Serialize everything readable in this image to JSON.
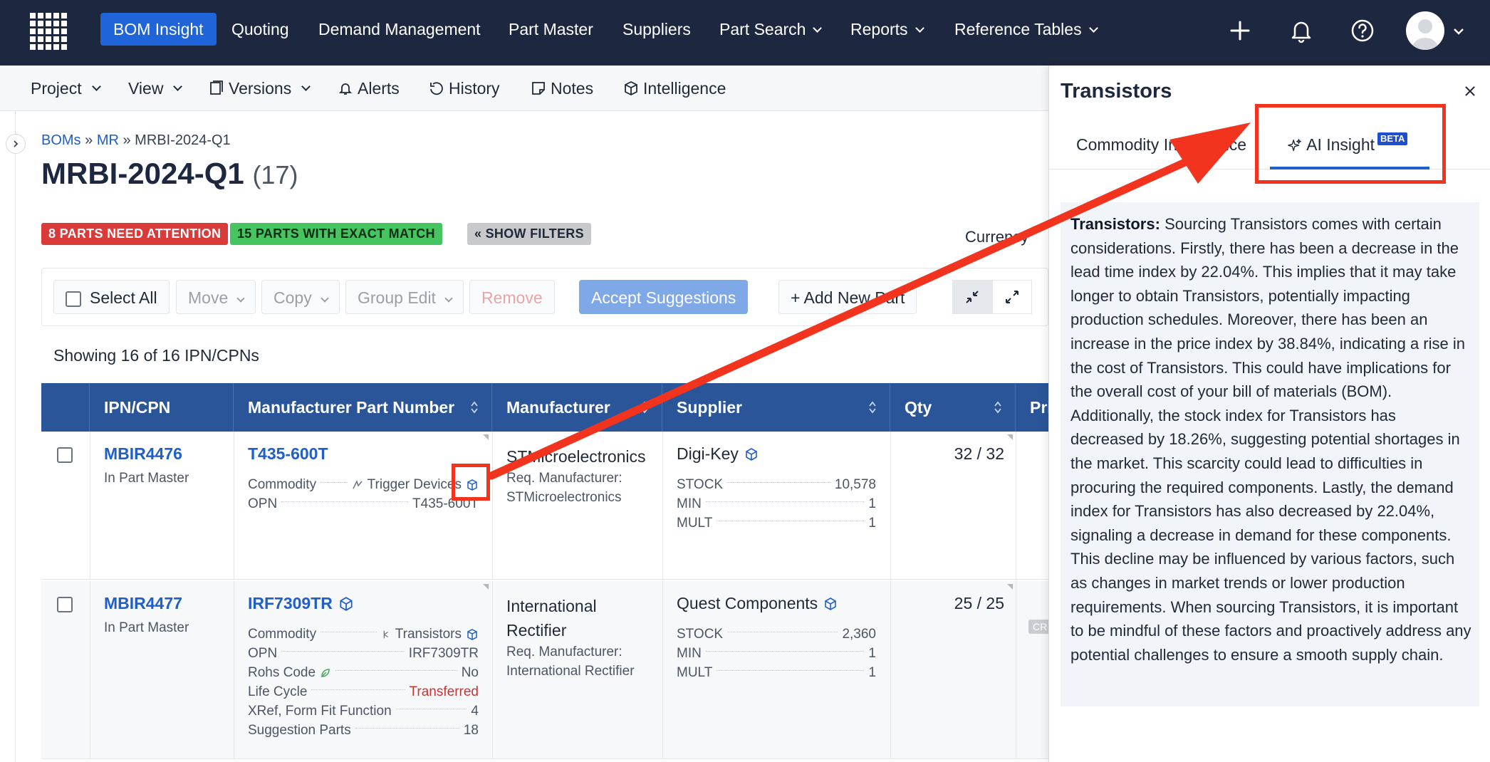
{
  "nav": {
    "items": [
      "BOM Insight",
      "Quoting",
      "Demand Management",
      "Part Master",
      "Suppliers",
      "Part Search",
      "Reports",
      "Reference Tables"
    ]
  },
  "toolbar": {
    "project": "Project",
    "view": "View",
    "versions": "Versions",
    "alerts": "Alerts",
    "history": "History",
    "notes": "Notes",
    "intelligence": "Intelligence"
  },
  "breadcrumb": {
    "boms": "BOMs",
    "sep": "»",
    "mr": "MR",
    "current": "MRBI-2024-Q1"
  },
  "page": {
    "title": "MRBI-2024-Q1",
    "count": "(17)"
  },
  "badges": {
    "attention": "8 PARTS NEED ATTENTION",
    "exact": "15 PARTS WITH EXACT MATCH",
    "filters": "« SHOW FILTERS"
  },
  "currency_label": "Currency",
  "actions": {
    "select_all": "Select All",
    "move": "Move",
    "copy": "Copy",
    "group_edit": "Group Edit",
    "remove": "Remove",
    "accept": "Accept Suggestions",
    "add_new": "+ Add New Part"
  },
  "showing": "Showing 16 of 16 IPN/CPNs",
  "table": {
    "headers": [
      "IPN/CPN",
      "Manufacturer Part Number",
      "Manufacturer",
      "Supplier",
      "Qty",
      "Pri"
    ],
    "rows": [
      {
        "ipn": "MBIR4476",
        "ipn_sub": "In Part Master",
        "mpn": "T435-600T",
        "attrs": [
          {
            "k": "Commodity",
            "v": "Trigger Devices"
          },
          {
            "k": "OPN",
            "v": "T435-600T"
          }
        ],
        "manufacturer": "STMicroelectronics",
        "req_label": "Req. Manufacturer:",
        "req_value": "STMicroelectronics",
        "supplier": "Digi-Key",
        "stock": [
          {
            "k": "STOCK",
            "v": "10,578"
          },
          {
            "k": "MIN",
            "v": "1"
          },
          {
            "k": "MULT",
            "v": "1"
          }
        ],
        "qty": "32 / 32"
      },
      {
        "ipn": "MBIR4477",
        "ipn_sub": "In Part Master",
        "mpn": "IRF7309TR",
        "attrs": [
          {
            "k": "Commodity",
            "v": "Transistors"
          },
          {
            "k": "OPN",
            "v": "IRF7309TR"
          },
          {
            "k": "Rohs Code",
            "v": "No"
          },
          {
            "k": "Life Cycle",
            "v": "Transferred"
          },
          {
            "k": "XRef, Form Fit Function",
            "v": "4"
          },
          {
            "k": "Suggestion Parts",
            "v": "18"
          }
        ],
        "manufacturer_l1": "International",
        "manufacturer_l2": "Rectifier",
        "req_label": "Req. Manufacturer:",
        "req_value": "International Rectifier",
        "supplier": "Quest Components",
        "stock": [
          {
            "k": "STOCK",
            "v": "2,360"
          },
          {
            "k": "MIN",
            "v": "1"
          },
          {
            "k": "MULT",
            "v": "1"
          }
        ],
        "qty": "25 / 25",
        "price_badge": "CR"
      }
    ]
  },
  "panel": {
    "title": "Transistors",
    "tab_commodity": "Commodity Intelligence",
    "tab_ai": "AI Insight",
    "beta": "BETA",
    "lead": "Transistors:",
    "body": "Sourcing Transistors comes with certain considerations. Firstly, there has been a decrease in the lead time index by 22.04%. This implies that it may take longer to obtain Transistors, potentially impacting production schedules. Moreover, there has been an increase in the price index by 38.84%, indicating a rise in the cost of Transistors. This could have implications for the overall cost of your bill of materials (BOM). Additionally, the stock index for Transistors has decreased by 18.26%, suggesting potential shortages in the market. This scarcity could lead to difficulties in procuring the required components. Lastly, the demand index for Transistors has also decreased by 22.04%, signaling a decrease in demand for these components. This decline may be influenced by various factors, such as changes in market trends or lower production requirements. When sourcing Transistors, it is important to be mindful of these factors and proactively address any potential challenges to ensure a smooth supply chain."
  },
  "colors": {
    "nav_bg": "#1d2840",
    "active_nav": "#1f64d8",
    "table_header": "#2a5599",
    "link": "#1f5fc7",
    "annotation": "#f2331e"
  }
}
